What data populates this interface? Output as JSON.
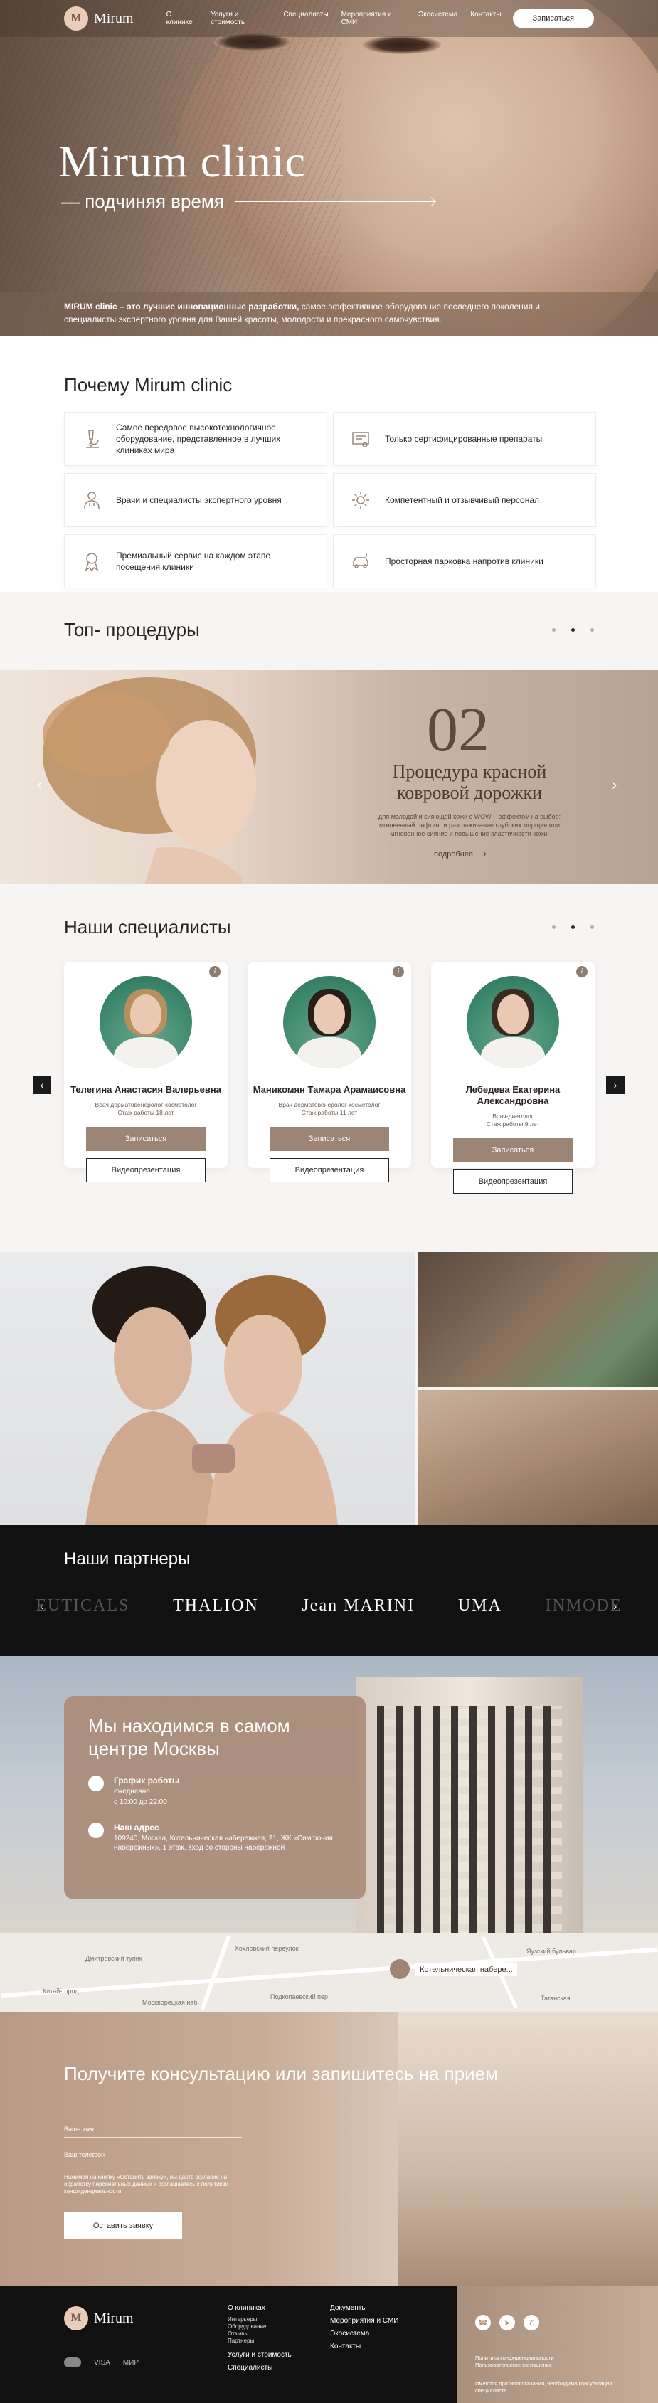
{
  "header": {
    "logo_text": "Mirum",
    "logo_letter": "M",
    "nav": [
      "О клинике",
      "Услуги и стоимость",
      "Специалисты",
      "Мероприятия и СМИ",
      "Экосистема",
      "Контакты"
    ],
    "cta": "Записаться"
  },
  "hero": {
    "title": "Mirum clinic",
    "subtitle": "— подчиняя время",
    "desc_bold": "MIRUM clinic – это лучшие инновационные разработки,",
    "desc_rest": " самое эффективное оборудование последнего поколения и специалисты экспертного уровня для Вашей красоты, молодости и прекрасного самочувствия."
  },
  "why": {
    "title": "Почему Mirum clinic",
    "items": [
      {
        "text": "Самое передовое высокотехнологичное оборудование, представленное в лучших клиниках мира",
        "icon": "microscope-icon"
      },
      {
        "text": "Только сертифицированные препараты",
        "icon": "certificate-icon"
      },
      {
        "text": "Врачи и специалисты экспертного уровня",
        "icon": "doctor-icon"
      },
      {
        "text": "Компетентный и отзывчивый персонал",
        "icon": "gear-icon"
      },
      {
        "text": "Премиальный сервис на каждом этапе посещения клиники",
        "icon": "award-icon"
      },
      {
        "text": "Просторная парковка напротив клиники",
        "icon": "parking-icon"
      }
    ]
  },
  "procedures": {
    "title": "Топ- процедуры",
    "number": "02",
    "name": "Процедура красной ковровой дорожки",
    "desc": "для молодой и сияющей кожи с WOW – эффектом на выбор: мгновенный лифтинг и разглаживание глубоких морщин или мгновенное сияние и повышение эластичности кожи.",
    "more": "подробнее ⟶"
  },
  "specialists": {
    "title": "Наши специалисты",
    "book_label": "Записаться",
    "video_label": "Видеопрезентация",
    "items": [
      {
        "name": "Телегина Анастасия Валерьевна",
        "role": "Врач дерматовенеролог-косметолог",
        "exp": "Стаж работы 18 лет",
        "hair": "#b89060"
      },
      {
        "name": "Маникомян Тамара Арамаисовна",
        "role": "Врач дерматовенеролог-косметолог",
        "exp": "Стаж работы 11 лет",
        "hair": "#2a1d16"
      },
      {
        "name": "Лебедева Екатерина Александровна",
        "role": "Врач-диетолог",
        "exp": "Стаж работы 9 лет",
        "hair": "#3b2a20"
      }
    ]
  },
  "partners": {
    "title": "Наши партнеры",
    "logos": [
      "EUTICALS",
      "THALION",
      "Jean MARINI",
      "UMA",
      "INMODE"
    ]
  },
  "location": {
    "title": "Мы находимся в самом центре Москвы",
    "hours_title": "График работы",
    "hours_days": "ежедневно",
    "hours_time": "с 10:00 до 22:00",
    "addr_title": "Наш адрес",
    "addr": "109240, Москва, Котельническая набережная, 21, ЖК «Симфония набережных», 1 этаж, вход со стороны набережной"
  },
  "map": {
    "tag": "Котельническая набере...",
    "labels": [
      "Дмитровский тупик",
      "Китай-город",
      "Хохловский переулок",
      "Подкопаевский пер.",
      "Яузский бульвар",
      "Москворецкая наб.",
      "Таганская"
    ]
  },
  "consult": {
    "title": "Получите консультацию или запишитесь на прием",
    "name_placeholder": "Ваше имя",
    "phone_placeholder": "Ваш телефон",
    "note": "Нажимая на кнопку «Оставить заявку», вы даете согласие на обработку персональных данных и соглашаетесь с политикой конфиденциальности",
    "button": "Оставить заявку"
  },
  "footer": {
    "logo_text": "Mirum",
    "logo_letter": "M",
    "pay": [
      "VISA",
      "МИР"
    ],
    "col1": [
      "О клиниках",
      "Услуги и стоимость",
      "Специалисты"
    ],
    "col1_sub": [
      "Интерьеры",
      "Оборудование",
      "Отзывы",
      "Партнеры"
    ],
    "col2": [
      "Документы",
      "Мероприятия и СМИ",
      "Экосистема",
      "Контакты"
    ],
    "legal": [
      "Политика конфиденциальности",
      "Пользовательское соглашение"
    ],
    "legal_note": "Имеются противопоказания, необходима консультация специалиста"
  }
}
